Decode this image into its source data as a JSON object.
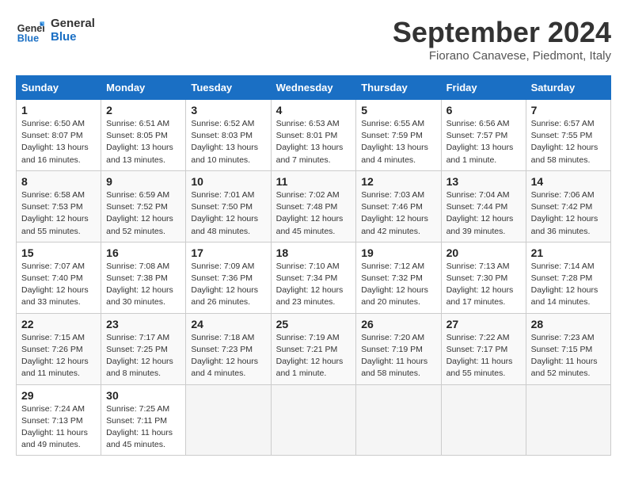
{
  "header": {
    "logo_line1": "General",
    "logo_line2": "Blue",
    "month": "September 2024",
    "location": "Fiorano Canavese, Piedmont, Italy"
  },
  "weekdays": [
    "Sunday",
    "Monday",
    "Tuesday",
    "Wednesday",
    "Thursday",
    "Friday",
    "Saturday"
  ],
  "weeks": [
    [
      {
        "day": "1",
        "info": "Sunrise: 6:50 AM\nSunset: 8:07 PM\nDaylight: 13 hours\nand 16 minutes."
      },
      {
        "day": "2",
        "info": "Sunrise: 6:51 AM\nSunset: 8:05 PM\nDaylight: 13 hours\nand 13 minutes."
      },
      {
        "day": "3",
        "info": "Sunrise: 6:52 AM\nSunset: 8:03 PM\nDaylight: 13 hours\nand 10 minutes."
      },
      {
        "day": "4",
        "info": "Sunrise: 6:53 AM\nSunset: 8:01 PM\nDaylight: 13 hours\nand 7 minutes."
      },
      {
        "day": "5",
        "info": "Sunrise: 6:55 AM\nSunset: 7:59 PM\nDaylight: 13 hours\nand 4 minutes."
      },
      {
        "day": "6",
        "info": "Sunrise: 6:56 AM\nSunset: 7:57 PM\nDaylight: 13 hours\nand 1 minute."
      },
      {
        "day": "7",
        "info": "Sunrise: 6:57 AM\nSunset: 7:55 PM\nDaylight: 12 hours\nand 58 minutes."
      }
    ],
    [
      {
        "day": "8",
        "info": "Sunrise: 6:58 AM\nSunset: 7:53 PM\nDaylight: 12 hours\nand 55 minutes."
      },
      {
        "day": "9",
        "info": "Sunrise: 6:59 AM\nSunset: 7:52 PM\nDaylight: 12 hours\nand 52 minutes."
      },
      {
        "day": "10",
        "info": "Sunrise: 7:01 AM\nSunset: 7:50 PM\nDaylight: 12 hours\nand 48 minutes."
      },
      {
        "day": "11",
        "info": "Sunrise: 7:02 AM\nSunset: 7:48 PM\nDaylight: 12 hours\nand 45 minutes."
      },
      {
        "day": "12",
        "info": "Sunrise: 7:03 AM\nSunset: 7:46 PM\nDaylight: 12 hours\nand 42 minutes."
      },
      {
        "day": "13",
        "info": "Sunrise: 7:04 AM\nSunset: 7:44 PM\nDaylight: 12 hours\nand 39 minutes."
      },
      {
        "day": "14",
        "info": "Sunrise: 7:06 AM\nSunset: 7:42 PM\nDaylight: 12 hours\nand 36 minutes."
      }
    ],
    [
      {
        "day": "15",
        "info": "Sunrise: 7:07 AM\nSunset: 7:40 PM\nDaylight: 12 hours\nand 33 minutes."
      },
      {
        "day": "16",
        "info": "Sunrise: 7:08 AM\nSunset: 7:38 PM\nDaylight: 12 hours\nand 30 minutes."
      },
      {
        "day": "17",
        "info": "Sunrise: 7:09 AM\nSunset: 7:36 PM\nDaylight: 12 hours\nand 26 minutes."
      },
      {
        "day": "18",
        "info": "Sunrise: 7:10 AM\nSunset: 7:34 PM\nDaylight: 12 hours\nand 23 minutes."
      },
      {
        "day": "19",
        "info": "Sunrise: 7:12 AM\nSunset: 7:32 PM\nDaylight: 12 hours\nand 20 minutes."
      },
      {
        "day": "20",
        "info": "Sunrise: 7:13 AM\nSunset: 7:30 PM\nDaylight: 12 hours\nand 17 minutes."
      },
      {
        "day": "21",
        "info": "Sunrise: 7:14 AM\nSunset: 7:28 PM\nDaylight: 12 hours\nand 14 minutes."
      }
    ],
    [
      {
        "day": "22",
        "info": "Sunrise: 7:15 AM\nSunset: 7:26 PM\nDaylight: 12 hours\nand 11 minutes."
      },
      {
        "day": "23",
        "info": "Sunrise: 7:17 AM\nSunset: 7:25 PM\nDaylight: 12 hours\nand 8 minutes."
      },
      {
        "day": "24",
        "info": "Sunrise: 7:18 AM\nSunset: 7:23 PM\nDaylight: 12 hours\nand 4 minutes."
      },
      {
        "day": "25",
        "info": "Sunrise: 7:19 AM\nSunset: 7:21 PM\nDaylight: 12 hours\nand 1 minute."
      },
      {
        "day": "26",
        "info": "Sunrise: 7:20 AM\nSunset: 7:19 PM\nDaylight: 11 hours\nand 58 minutes."
      },
      {
        "day": "27",
        "info": "Sunrise: 7:22 AM\nSunset: 7:17 PM\nDaylight: 11 hours\nand 55 minutes."
      },
      {
        "day": "28",
        "info": "Sunrise: 7:23 AM\nSunset: 7:15 PM\nDaylight: 11 hours\nand 52 minutes."
      }
    ],
    [
      {
        "day": "29",
        "info": "Sunrise: 7:24 AM\nSunset: 7:13 PM\nDaylight: 11 hours\nand 49 minutes."
      },
      {
        "day": "30",
        "info": "Sunrise: 7:25 AM\nSunset: 7:11 PM\nDaylight: 11 hours\nand 45 minutes."
      },
      null,
      null,
      null,
      null,
      null
    ]
  ]
}
